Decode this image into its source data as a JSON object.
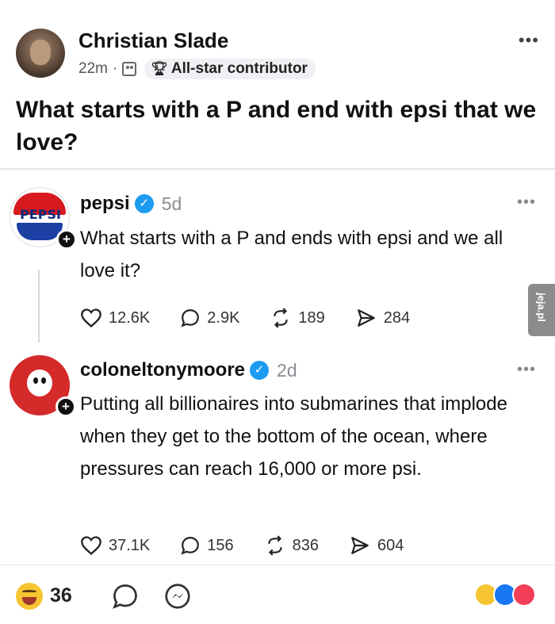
{
  "post": {
    "author": "Christian Slade",
    "time": "22m",
    "separator": "·",
    "badge": "All-star contributor",
    "more": "•••",
    "text": "What starts with a P and end with epsi that we love?"
  },
  "threads": [
    {
      "avatar_label": "PEPSI",
      "username": "pepsi",
      "time": "5d",
      "more": "•••",
      "text": "What starts with a P and ends with epsi and we all love it?",
      "likes": "12.6K",
      "comments": "2.9K",
      "reposts": "189",
      "shares": "284"
    },
    {
      "username": "coloneltonymoore",
      "time": "2d",
      "more": "•••",
      "text": "Putting all billionaires into submarines that implode when they get to the bottom of the ocean, where pressures can reach 16,000 or more psi.",
      "likes": "37.1K",
      "comments": "156",
      "reposts": "836",
      "shares": "604"
    }
  ],
  "footer": {
    "reaction_count": "36"
  },
  "watermark": "jeja.pl",
  "icons": {
    "plus": "+",
    "verified": "✓",
    "trophy": "♀"
  },
  "colors": {
    "verified": "#1d9bf0",
    "pepsi_red": "#d71920",
    "pepsi_blue": "#1b3fa3",
    "colonel_red": "#d42a2a"
  }
}
